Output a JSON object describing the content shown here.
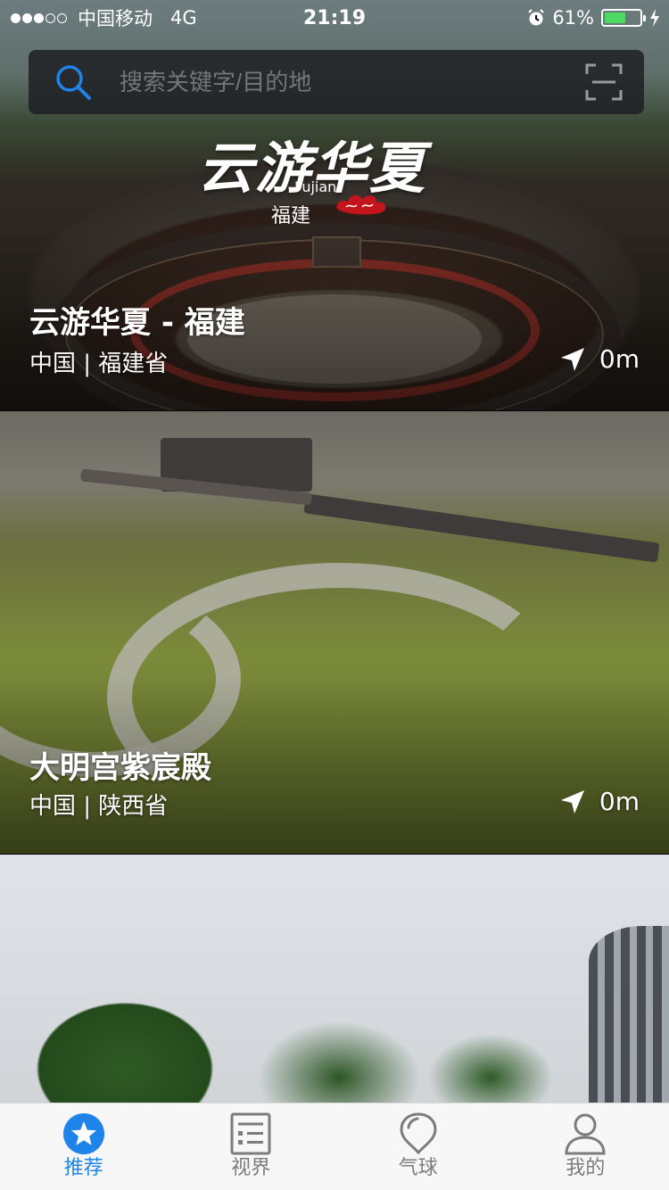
{
  "status_bar": {
    "carrier": "中国移动",
    "network": "4G",
    "time": "21:19",
    "battery_percent": "61%",
    "battery_level": 0.61,
    "signal_bars_filled": 3,
    "signal_bars_total": 5
  },
  "search": {
    "placeholder": "搜索关键字/目的地",
    "search_icon": "search-icon",
    "scan_icon": "scan-icon"
  },
  "cards": [
    {
      "logo_text": "云游华夏",
      "logo_en": "Fujian",
      "logo_sub": "福建",
      "title": "云游华夏 - 福建",
      "location": "中国 | 福建省",
      "distance": "0m"
    },
    {
      "title": "大明宫紫宸殿",
      "location": "中国 | 陕西省",
      "distance": "0m"
    }
  ],
  "tabs": [
    {
      "label": "推荐",
      "icon": "star-icon",
      "active": true
    },
    {
      "label": "视界",
      "icon": "list-icon",
      "active": false
    },
    {
      "label": "气球",
      "icon": "balloon-icon",
      "active": false
    },
    {
      "label": "我的",
      "icon": "person-icon",
      "active": false
    }
  ],
  "colors": {
    "accent": "#1e84ea",
    "tab_inactive": "#7c7c7c",
    "battery_green": "#4cd964"
  }
}
